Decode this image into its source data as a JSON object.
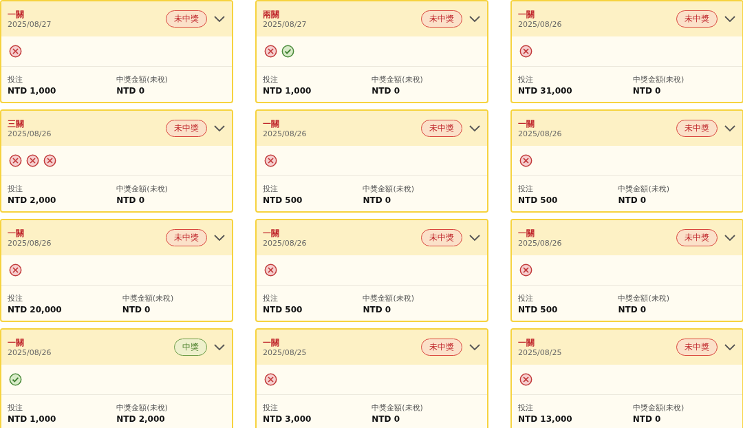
{
  "cards": [
    {
      "title": "一關",
      "date": "2025/08/27",
      "status": {
        "text": "未中獎",
        "won": false
      },
      "results": [
        {
          "won": false
        }
      ],
      "stake_label": "投注",
      "stake": "NTD 1,000",
      "prize_label": "中獎金額(未稅)",
      "prize": "NTD 0"
    },
    {
      "title": "兩關",
      "date": "2025/08/27",
      "status": {
        "text": "未中獎",
        "won": false
      },
      "results": [
        {
          "won": false
        },
        {
          "won": true
        }
      ],
      "stake_label": "投注",
      "stake": "NTD 1,000",
      "prize_label": "中獎金額(未稅)",
      "prize": "NTD 0"
    },
    {
      "title": "一關",
      "date": "2025/08/26",
      "status": {
        "text": "未中獎",
        "won": false
      },
      "results": [
        {
          "won": false
        }
      ],
      "stake_label": "投注",
      "stake": "NTD 31,000",
      "prize_label": "中獎金額(未稅)",
      "prize": "NTD 0"
    },
    {
      "title": "三關",
      "date": "2025/08/26",
      "status": {
        "text": "未中獎",
        "won": false
      },
      "results": [
        {
          "won": false
        },
        {
          "won": false
        },
        {
          "won": false
        }
      ],
      "stake_label": "投注",
      "stake": "NTD 2,000",
      "prize_label": "中獎金額(未稅)",
      "prize": "NTD 0"
    },
    {
      "title": "一關",
      "date": "2025/08/26",
      "status": {
        "text": "未中獎",
        "won": false
      },
      "results": [
        {
          "won": false
        }
      ],
      "stake_label": "投注",
      "stake": "NTD 500",
      "prize_label": "中獎金額(未稅)",
      "prize": "NTD 0"
    },
    {
      "title": "一關",
      "date": "2025/08/26",
      "status": {
        "text": "未中獎",
        "won": false
      },
      "results": [
        {
          "won": false
        }
      ],
      "stake_label": "投注",
      "stake": "NTD 500",
      "prize_label": "中獎金額(未稅)",
      "prize": "NTD 0"
    },
    {
      "title": "一關",
      "date": "2025/08/26",
      "status": {
        "text": "未中獎",
        "won": false
      },
      "results": [
        {
          "won": false
        }
      ],
      "stake_label": "投注",
      "stake": "NTD 20,000",
      "prize_label": "中獎金額(未稅)",
      "prize": "NTD 0"
    },
    {
      "title": "一關",
      "date": "2025/08/26",
      "status": {
        "text": "未中獎",
        "won": false
      },
      "results": [
        {
          "won": false
        }
      ],
      "stake_label": "投注",
      "stake": "NTD 500",
      "prize_label": "中獎金額(未稅)",
      "prize": "NTD 0"
    },
    {
      "title": "一關",
      "date": "2025/08/26",
      "status": {
        "text": "未中獎",
        "won": false
      },
      "results": [
        {
          "won": false
        }
      ],
      "stake_label": "投注",
      "stake": "NTD 500",
      "prize_label": "中獎金額(未稅)",
      "prize": "NTD 0"
    },
    {
      "title": "一關",
      "date": "2025/08/26",
      "status": {
        "text": "中獎",
        "won": true
      },
      "results": [
        {
          "won": true
        }
      ],
      "stake_label": "投注",
      "stake": "NTD 1,000",
      "prize_label": "中獎金額(未稅)",
      "prize": "NTD 2,000"
    },
    {
      "title": "一關",
      "date": "2025/08/25",
      "status": {
        "text": "未中獎",
        "won": false
      },
      "results": [
        {
          "won": false
        }
      ],
      "stake_label": "投注",
      "stake": "NTD 3,000",
      "prize_label": "中獎金額(未稅)",
      "prize": "NTD 0"
    },
    {
      "title": "一關",
      "date": "2025/08/25",
      "status": {
        "text": "未中獎",
        "won": false
      },
      "results": [
        {
          "won": false
        }
      ],
      "stake_label": "投注",
      "stake": "NTD 13,000",
      "prize_label": "中獎金額(未稅)",
      "prize": "NTD 0"
    }
  ]
}
